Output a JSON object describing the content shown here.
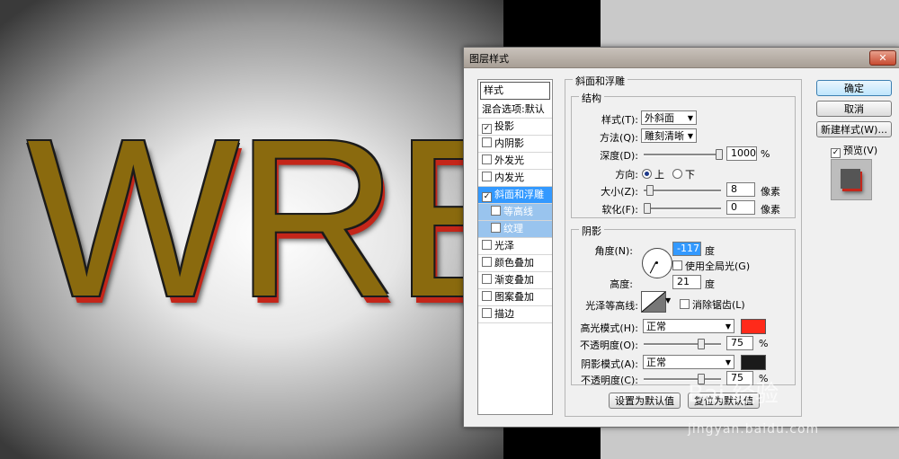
{
  "canvas": {
    "art_text": "WRE"
  },
  "dialog": {
    "title": "图层样式",
    "close_glyph": "✕",
    "styles_list": {
      "header": "样式",
      "items": [
        {
          "label": "混合选项:默认",
          "checkbox": false,
          "checked": false
        },
        {
          "label": "投影",
          "checkbox": true,
          "checked": true
        },
        {
          "label": "内阴影",
          "checkbox": true,
          "checked": false
        },
        {
          "label": "外发光",
          "checkbox": true,
          "checked": false
        },
        {
          "label": "内发光",
          "checkbox": true,
          "checked": false
        },
        {
          "label": "斜面和浮雕",
          "checkbox": true,
          "checked": true
        },
        {
          "label": "等高线",
          "checkbox": true,
          "checked": false
        },
        {
          "label": "纹理",
          "checkbox": true,
          "checked": false
        },
        {
          "label": "光泽",
          "checkbox": true,
          "checked": false
        },
        {
          "label": "颜色叠加",
          "checkbox": true,
          "checked": false
        },
        {
          "label": "渐变叠加",
          "checkbox": true,
          "checked": false
        },
        {
          "label": "图案叠加",
          "checkbox": true,
          "checked": false
        },
        {
          "label": "描边",
          "checkbox": true,
          "checked": false
        }
      ]
    },
    "bevel": {
      "section_title": "斜面和浮雕",
      "structure_title": "结构",
      "style_label": "样式(T):",
      "style_value": "外斜面",
      "technique_label": "方法(Q):",
      "technique_value": "雕刻清晰",
      "depth_label": "深度(D):",
      "depth_value": "1000",
      "depth_unit": "%",
      "direction_label": "方向:",
      "direction_up": "上",
      "direction_down": "下",
      "direction_selected": "上",
      "size_label": "大小(Z):",
      "size_value": "8",
      "size_unit": "像素",
      "soften_label": "软化(F):",
      "soften_value": "0",
      "soften_unit": "像素",
      "sliders": {
        "depth": 1.0,
        "size": 0.04,
        "soften": 0.0
      }
    },
    "shading": {
      "title": "阴影",
      "angle_label": "角度(N):",
      "angle_value": "-117",
      "angle_unit": "度",
      "global_light_label": "使用全局光(G)",
      "altitude_label": "高度:",
      "altitude_value": "21",
      "altitude_unit": "度",
      "gloss_contour_label": "光泽等高线:",
      "anti_alias_label": "消除锯齿(L)",
      "highlight_mode_label": "高光模式(H):",
      "highlight_mode_value": "正常",
      "highlight_color": "#ff2a1a",
      "highlight_opacity_label": "不透明度(O):",
      "highlight_opacity_value": "75",
      "highlight_opacity_unit": "%",
      "shadow_mode_label": "阴影模式(A):",
      "shadow_mode_value": "正常",
      "shadow_color": "#1a1a1a",
      "shadow_opacity_label": "不透明度(C):",
      "shadow_opacity_value": "75",
      "shadow_opacity_unit": "%",
      "sliders": {
        "highlight_opacity": 0.75,
        "shadow_opacity": 0.75
      }
    },
    "bottom_buttons": {
      "make_default": "设置为默认值",
      "reset_default": "复位为默认值"
    },
    "right_buttons": {
      "ok": "确定",
      "cancel": "取消",
      "new_style": "新建样式(W)...",
      "preview": "预览(V)"
    },
    "preview_checked": true
  },
  "watermark": {
    "line1": "Bai 经验",
    "line2": "jingyan.baidu.com"
  }
}
